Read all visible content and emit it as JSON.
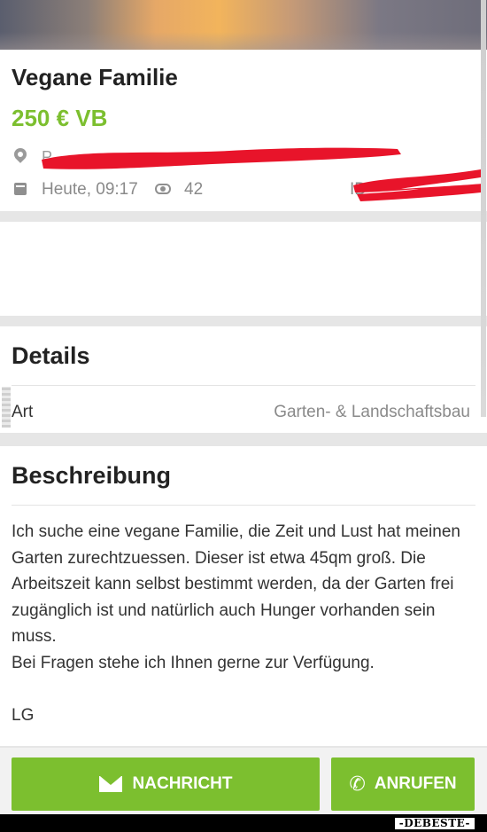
{
  "listing": {
    "title": "Vegane Familie",
    "price": "250 € VB",
    "location_partial": "P",
    "date": "Heute, 09:17",
    "views": "42",
    "id_label": "ID"
  },
  "details": {
    "title": "Details",
    "rows": [
      {
        "label": "Art",
        "value": "Garten- & Landschaftsbau"
      }
    ]
  },
  "description": {
    "title": "Beschreibung",
    "text": "Ich suche eine vegane Familie, die Zeit und Lust hat meinen Garten zurechtzuessen. Dieser ist etwa 45qm groß. Die Arbeitszeit kann selbst bestimmt werden, da der Garten frei zugänglich ist und natürlich auch Hunger vorhanden sein muss.\nBei Fragen stehe ich Ihnen gerne zur Verfügung.",
    "closing": "LG"
  },
  "actions": {
    "message_label": "NACHRICHT",
    "call_label": "ANRUFEN"
  },
  "watermark": "-DEBESTE-",
  "colors": {
    "accent_green": "#7cbf2f",
    "redaction_red": "#e8142a"
  },
  "icons": [
    "location-pin-icon",
    "calendar-icon",
    "eye-icon",
    "envelope-icon",
    "phone-icon"
  ]
}
